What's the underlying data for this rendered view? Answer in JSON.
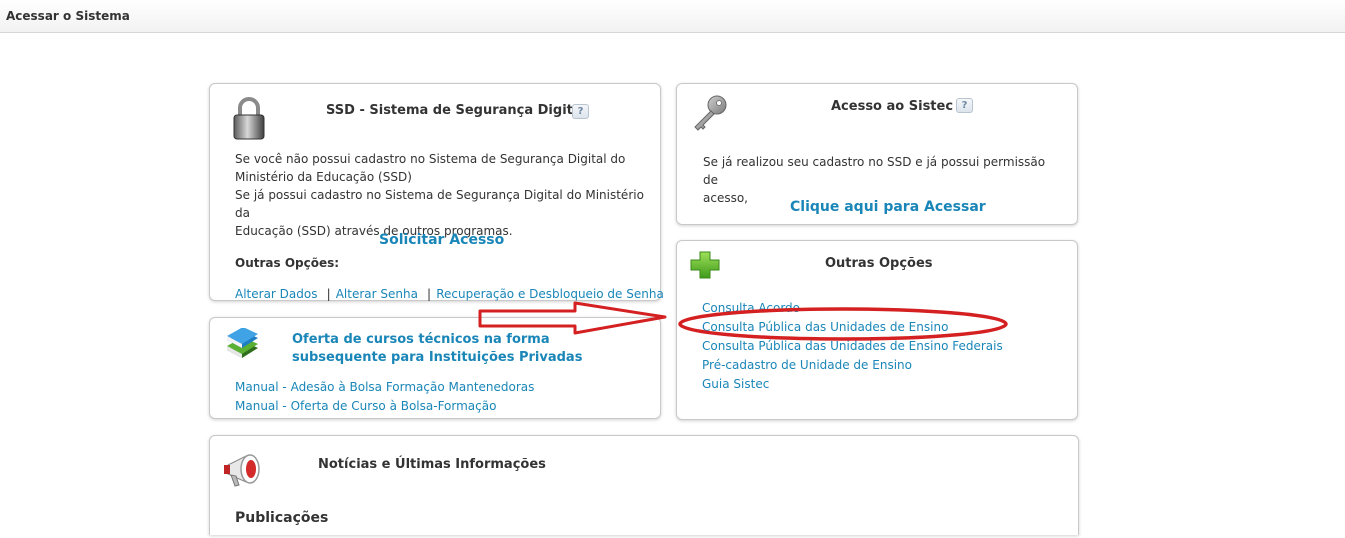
{
  "header": {
    "title": "Acessar o Sistema"
  },
  "ssd": {
    "title": "SSD - Sistema de Segurança Digital",
    "help": "?",
    "line1": "Se você não possui cadastro no Sistema de Segurança Digital do",
    "line2": "Ministério da Educação (SSD)",
    "line3": "Se já possui cadastro no Sistema de Segurança Digital do Ministério da",
    "line4": "Educação (SSD) através de outros programas.",
    "request_link": "Solicitar Acesso",
    "other_label": "Outras Opções:",
    "links": [
      "Alterar Dados",
      "Alterar Senha",
      "Recuperação e Desbloqueio de Senha"
    ],
    "separator": "|"
  },
  "sistec": {
    "title": "Acesso ao Sistec",
    "help": "?",
    "line1": "Se já realizou seu cadastro no SSD e já possui permissão de",
    "line2": "acesso,",
    "access_link": "Clique aqui para Acessar"
  },
  "oferta": {
    "title_line1": "Oferta de cursos técnicos na forma",
    "title_line2": "subsequente para Instituições Privadas",
    "links": [
      "Manual - Adesão à Bolsa Formação Mantenedoras",
      "Manual - Oferta de Curso à Bolsa-Formação"
    ]
  },
  "outras": {
    "title": "Outras Opções",
    "links": [
      "Consulta Acordo",
      "Consulta Pública das Unidades de Ensino",
      "Consulta Pública das Unidades de Ensino Federais",
      "Pré-cadastro de Unidade de Ensino",
      "Guia Sistec"
    ]
  },
  "noticias": {
    "title": "Notícias e Últimas Informações",
    "section": "Publicações"
  },
  "colors": {
    "link": "#1a86b8",
    "annotation": "#d42020",
    "plus": "#5cb82c"
  }
}
